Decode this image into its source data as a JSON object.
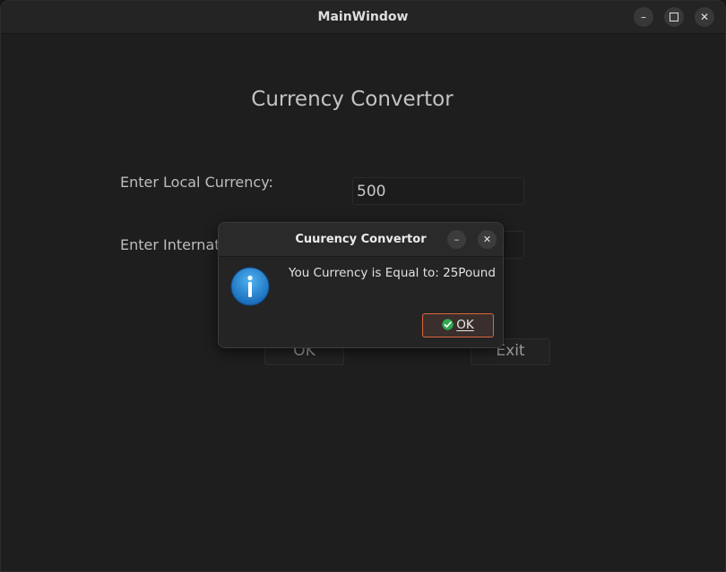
{
  "window": {
    "title": "MainWindow",
    "minimize_glyph": "–",
    "maximize_glyph": "☐",
    "close_glyph": "✕"
  },
  "main": {
    "heading": "Currency Convertor",
    "local_label": "Enter Local Currency:",
    "local_value": "500",
    "international_label": "Enter International Currency:",
    "international_value": "",
    "ok_button": "OK",
    "exit_button": "Exit"
  },
  "dialog": {
    "title": "Cuurency Convertor",
    "minimize_glyph": "–",
    "close_glyph": "✕",
    "message": "You Currency is Equal to: 25Pound",
    "ok_button": "OK",
    "icon": "information-icon",
    "accent_color": "#e0643d",
    "info_color": "#1f86d0"
  }
}
